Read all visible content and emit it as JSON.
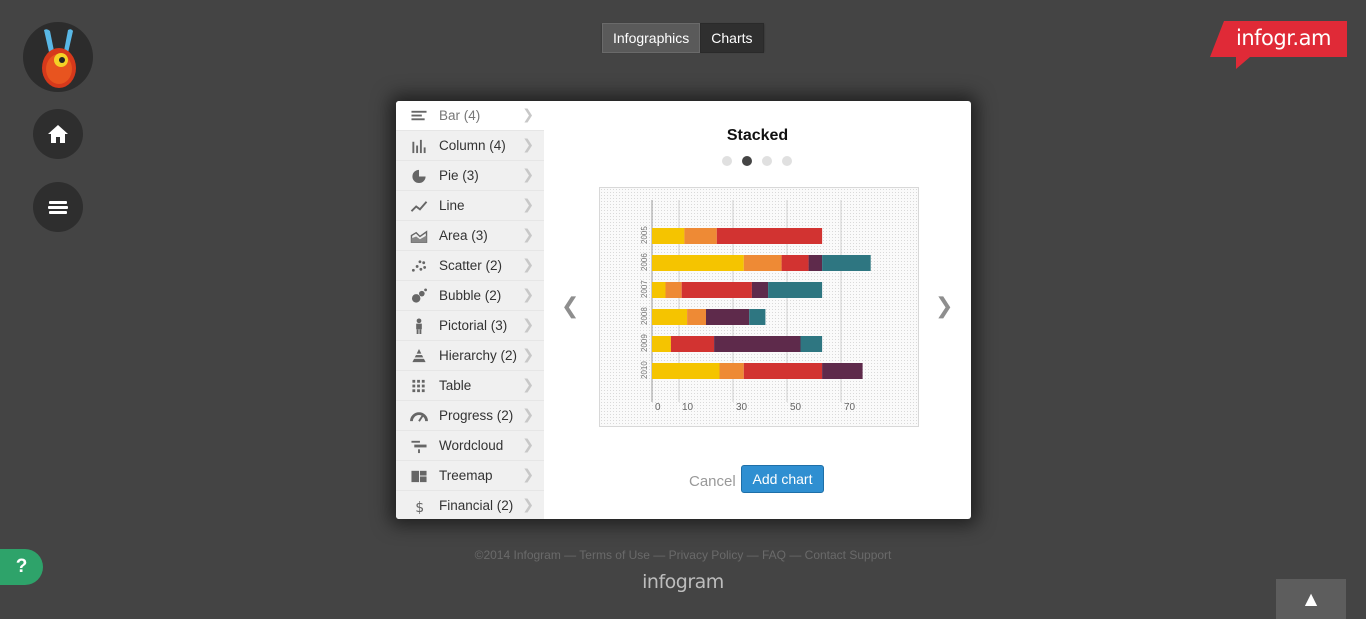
{
  "tabs": [
    {
      "label": "Infographics",
      "active": true
    },
    {
      "label": "Charts",
      "active": false
    }
  ],
  "brand": {
    "text": "infogr.am",
    "color": "#e02a37"
  },
  "nav": {
    "home_icon": "home-icon",
    "menu_icon": "stack-icon"
  },
  "chart_types": [
    {
      "label": "Bar (4)",
      "icon": "bar-chart-icon",
      "active": true
    },
    {
      "label": "Column (4)",
      "icon": "column-chart-icon"
    },
    {
      "label": "Pie (3)",
      "icon": "pie-chart-icon"
    },
    {
      "label": "Line",
      "icon": "line-chart-icon"
    },
    {
      "label": "Area (3)",
      "icon": "area-chart-icon"
    },
    {
      "label": "Scatter (2)",
      "icon": "scatter-chart-icon"
    },
    {
      "label": "Bubble (2)",
      "icon": "bubble-chart-icon"
    },
    {
      "label": "Pictorial (3)",
      "icon": "person-icon"
    },
    {
      "label": "Hierarchy (2)",
      "icon": "pyramid-icon"
    },
    {
      "label": "Table",
      "icon": "table-icon"
    },
    {
      "label": "Progress (2)",
      "icon": "gauge-icon"
    },
    {
      "label": "Wordcloud",
      "icon": "wordcloud-icon"
    },
    {
      "label": "Treemap",
      "icon": "treemap-icon"
    },
    {
      "label": "Financial (2)",
      "icon": "dollar-icon"
    }
  ],
  "preview": {
    "title": "Stacked",
    "carousel_pages": 4,
    "carousel_active": 1
  },
  "actions": {
    "cancel": "Cancel",
    "add": "Add chart"
  },
  "footer": {
    "links": "©2014 Infogram — Terms of Use — Privacy Policy — FAQ — Contact Support",
    "logo": "infogram"
  },
  "help_label": "?",
  "colors": {
    "yellow": "#f5c400",
    "orange": "#ee8a35",
    "red": "#d23331",
    "purple": "#5e2a4b",
    "teal": "#2e7681"
  },
  "chart_data": {
    "type": "bar",
    "stacked": true,
    "orientation": "horizontal",
    "title": "",
    "categories": [
      "2005",
      "2006",
      "2007",
      "2008",
      "2009",
      "2010"
    ],
    "xticks": [
      0,
      10,
      30,
      50,
      70
    ],
    "xlim": [
      0,
      80
    ],
    "series": [
      {
        "color": "#f5c400",
        "values": [
          12,
          34,
          5,
          13,
          7,
          25
        ]
      },
      {
        "color": "#ee8a35",
        "values": [
          12,
          14,
          6,
          7,
          0,
          9
        ]
      },
      {
        "color": "#d23331",
        "values": [
          39,
          10,
          26,
          0,
          16,
          29
        ]
      },
      {
        "color": "#5e2a4b",
        "values": [
          0,
          5,
          6,
          16,
          32,
          15
        ]
      },
      {
        "color": "#2e7681",
        "values": [
          0,
          18,
          20,
          6,
          8,
          0
        ]
      }
    ]
  }
}
